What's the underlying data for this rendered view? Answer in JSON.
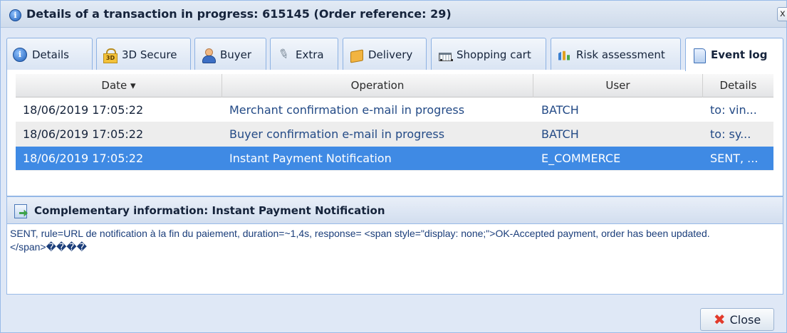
{
  "window": {
    "title": "Details of a transaction in progress: 615145 (Order reference: 29)",
    "close_glyph": "x"
  },
  "tabs": [
    {
      "label": "Details",
      "icon": "info-icon"
    },
    {
      "label": "3D Secure",
      "icon": "lock-icon"
    },
    {
      "label": "Buyer",
      "icon": "user-icon"
    },
    {
      "label": "Extra",
      "icon": "paperclip-icon"
    },
    {
      "label": "Delivery",
      "icon": "box-icon"
    },
    {
      "label": "Shopping cart",
      "icon": "cart-icon"
    },
    {
      "label": "Risk assessment",
      "icon": "chart-icon"
    },
    {
      "label": "Event log",
      "icon": "log-icon",
      "active": true
    }
  ],
  "grid": {
    "columns": [
      "Date ▾",
      "Operation",
      "User",
      "Details"
    ],
    "rows": [
      {
        "date": "18/06/2019 17:05:22",
        "operation": "Merchant confirmation e-mail in progress",
        "user": "BATCH",
        "details": "to: vin..."
      },
      {
        "date": "18/06/2019 17:05:22",
        "operation": "Buyer confirmation e-mail in progress",
        "user": "BATCH",
        "details": "to: sy..."
      },
      {
        "date": "18/06/2019 17:05:22",
        "operation": "Instant Payment Notification",
        "user": "E_COMMERCE",
        "details": "SENT, ..."
      }
    ]
  },
  "complementary": {
    "title": "Complementary information: Instant Payment Notification",
    "body": "SENT, rule=URL de notification à la fin du paiement, duration=~1,4s, response= <span style=\"display: none;\">OK-Accepted payment, order has been updated. </span>����"
  },
  "footer": {
    "close_label": "Close"
  },
  "colors": {
    "selected_row": "#3f8ae4",
    "close_icon": "#e23a2a"
  }
}
